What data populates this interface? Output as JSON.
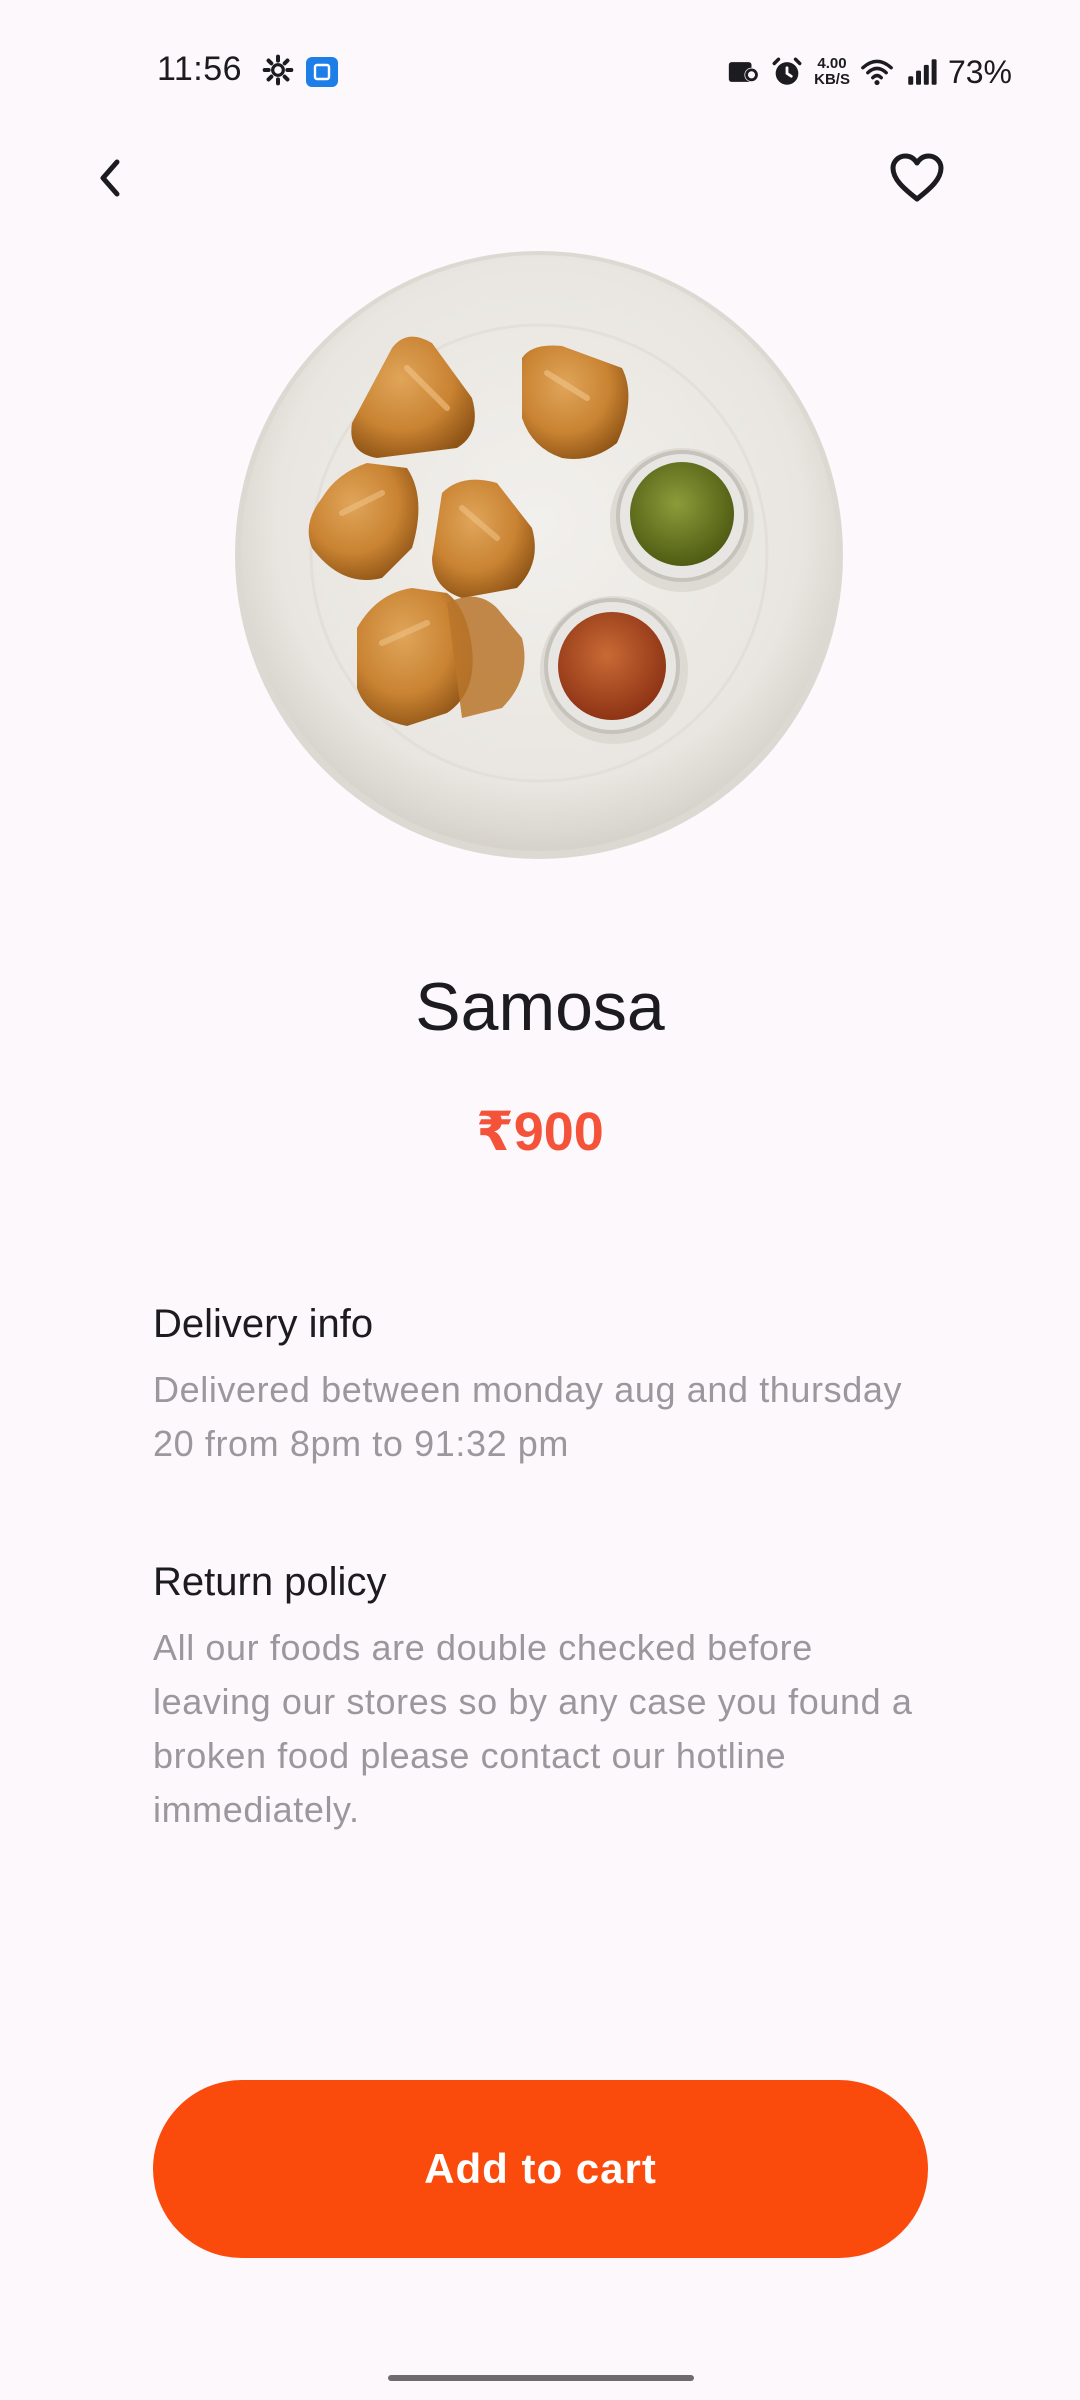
{
  "status_bar": {
    "time": "11:56",
    "net_speed_value": "4.00",
    "net_speed_unit": "KB/S",
    "battery": "73%",
    "icons": [
      "gear-icon",
      "app-notification-icon",
      "nfc-icon",
      "alarm-icon",
      "wifi-icon",
      "signal-icon"
    ]
  },
  "nav": {
    "back_icon": "chevron-left-icon",
    "favorite_icon": "heart-outline-icon"
  },
  "product": {
    "image_alt": "plate-of-samosas-with-chutneys",
    "name": "Samosa",
    "price": "₹900"
  },
  "delivery_info": {
    "title": "Delivery info",
    "body": "Delivered between monday aug and thursday 20 from 8pm to 91:32 pm"
  },
  "return_policy": {
    "title": "Return policy",
    "body": "All our foods are double checked before leaving our stores so by any case you found a broken food please contact our hotline immediately."
  },
  "cta": {
    "label": "Add to cart"
  },
  "colors": {
    "background": "#fcf8fb",
    "accent": "#fa4a0c",
    "price": "#f4533a",
    "muted_text": "#9b979c"
  }
}
